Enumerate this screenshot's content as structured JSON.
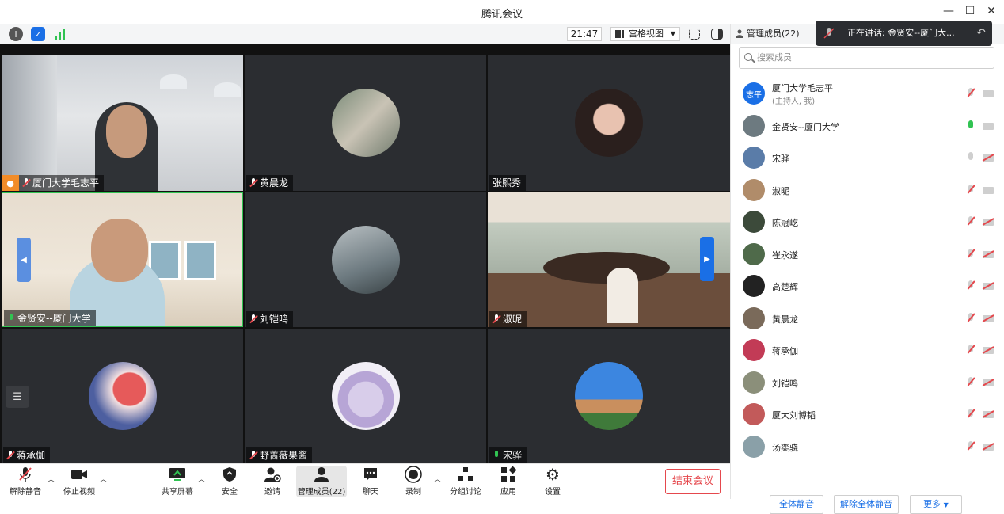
{
  "window": {
    "title": "腾讯会议"
  },
  "toolbar": {
    "time": "21:47",
    "view_mode": "宫格视图"
  },
  "panel": {
    "header": "管理成员(22)",
    "search_placeholder": "搜索成员",
    "members": [
      {
        "name": "厦门大学毛志平",
        "sub": "(主持人, 我)",
        "avatar_text": "志平",
        "mic": "muted",
        "cam": "on"
      },
      {
        "name": "金贤安--厦门大学",
        "mic": "speaking",
        "cam": "on"
      },
      {
        "name": "宋骅",
        "mic": "idle",
        "cam": "off"
      },
      {
        "name": "淑昵",
        "mic": "muted",
        "cam": "on"
      },
      {
        "name": "陈冠屹",
        "mic": "muted",
        "cam": "off"
      },
      {
        "name": "崔永遂",
        "mic": "muted",
        "cam": "off"
      },
      {
        "name": "高楚辉",
        "mic": "muted",
        "cam": "off"
      },
      {
        "name": "黄晨龙",
        "mic": "muted",
        "cam": "off"
      },
      {
        "name": "蒋承伽",
        "mic": "muted",
        "cam": "off"
      },
      {
        "name": "刘铠鸣",
        "mic": "muted",
        "cam": "off"
      },
      {
        "name": "厦大刘博韬",
        "mic": "muted",
        "cam": "off"
      },
      {
        "name": "汤奕骁",
        "mic": "muted",
        "cam": "off"
      }
    ],
    "mute_all": "全体静音",
    "unmute_all": "解除全体静音",
    "more": "更多"
  },
  "speaking_banner": "正在讲话: 金贤安--厦门大...",
  "tiles": [
    {
      "name": "厦门大学毛志平",
      "mic": "muted"
    },
    {
      "name": "黄晨龙",
      "mic": "muted"
    },
    {
      "name": "张熙秀",
      "mic": "none"
    },
    {
      "name": "金贤安--厦门大学",
      "mic": "on"
    },
    {
      "name": "刘铠鸣",
      "mic": "muted"
    },
    {
      "name": "淑昵",
      "mic": "muted"
    },
    {
      "name": "蒋承伽",
      "mic": "muted"
    },
    {
      "name": "野蔷薇果酱",
      "mic": "muted"
    },
    {
      "name": "宋骅",
      "mic": "on"
    }
  ],
  "bottom_bar": {
    "unmute": "解除静音",
    "stop_video": "停止视频",
    "share_screen": "共享屏幕",
    "security": "安全",
    "invite": "邀请",
    "manage_members": "管理成员(22)",
    "chat": "聊天",
    "record": "录制",
    "breakout": "分组讨论",
    "apps": "应用",
    "settings": "设置",
    "end_meeting": "结束会议"
  },
  "colors": {
    "accent": "#1a6fe6",
    "danger": "#e5484d",
    "speaking": "#31c352",
    "tile_bg": "#2b2d31"
  }
}
